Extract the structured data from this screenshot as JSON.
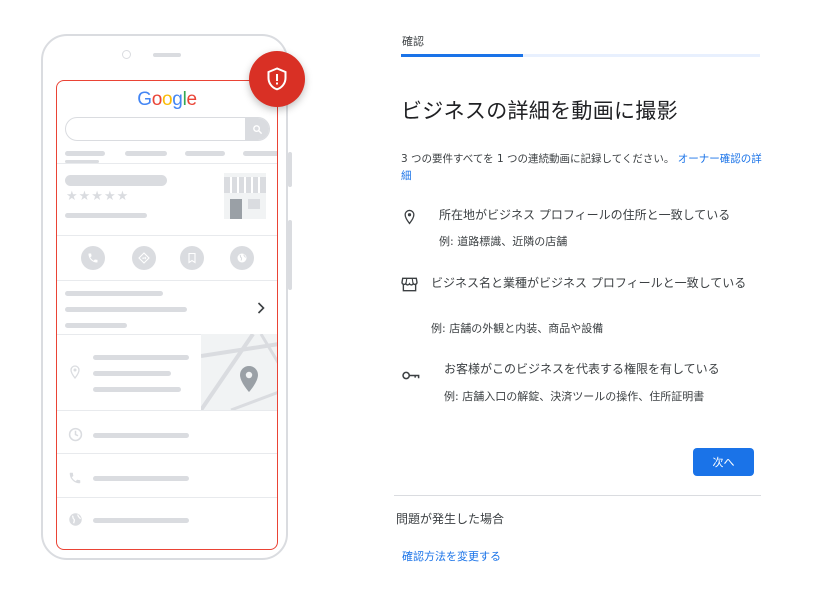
{
  "illustration": {
    "logo_letters": [
      {
        "ch": "G",
        "color": "#4285f4"
      },
      {
        "ch": "o",
        "color": "#ea4335"
      },
      {
        "ch": "o",
        "color": "#fbbc05"
      },
      {
        "ch": "g",
        "color": "#4285f4"
      },
      {
        "ch": "l",
        "color": "#34a853"
      },
      {
        "ch": "e",
        "color": "#ea4335"
      }
    ],
    "stars": "★★★★★",
    "badge_color": "#d93025",
    "accent_border": "#ea4335"
  },
  "tab": {
    "label": "確認",
    "progress_percent": 34
  },
  "heading": "ビジネスの詳細を動画に撮影",
  "intro": {
    "text": "3 つの要件すべてを 1 つの連続動画に記録してください。",
    "link": "オーナー確認の詳細"
  },
  "requirements": [
    {
      "icon": "location-pin-icon",
      "title": "所在地がビジネス プロフィールの住所と一致している",
      "example": "例: 道路標識、近隣の店舗"
    },
    {
      "icon": "storefront-icon",
      "title": "ビジネス名と業種がビジネス プロフィールと一致している",
      "example": "例: 店舗の外観と内装、商品や設備"
    },
    {
      "icon": "key-icon",
      "title": "お客様がこのビジネスを代表する権限を有している",
      "example": "例: 店舗入口の解錠、決済ツールの操作、住所証明書"
    }
  ],
  "next_button": "次へ",
  "trouble_label": "問題が発生した場合",
  "change_method_link": "確認方法を変更する",
  "colors": {
    "primary": "#1a73e8",
    "text": "#3c4043",
    "heading": "#202124",
    "placeholder": "#dadce0"
  }
}
